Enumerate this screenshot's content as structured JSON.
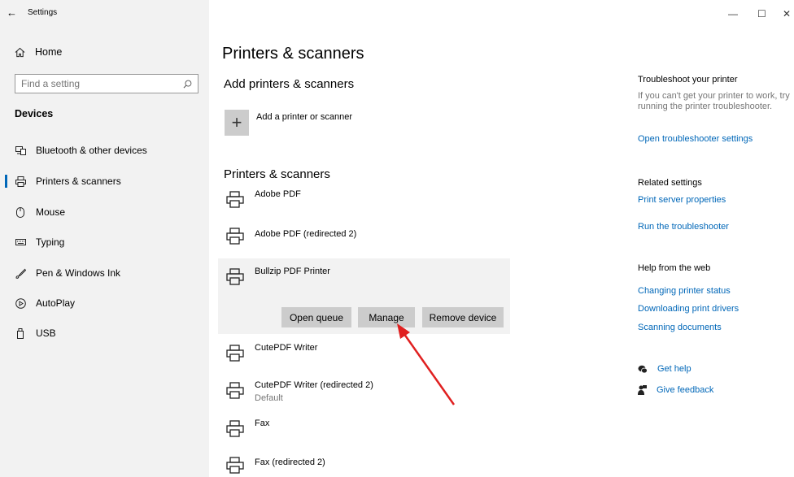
{
  "window": {
    "title": "Settings",
    "back_glyph": "←",
    "minimize_glyph": "—",
    "maximize_glyph": "☐",
    "close_glyph": "✕"
  },
  "sidebar": {
    "home_label": "Home",
    "search_placeholder": "Find a setting",
    "section_title": "Devices",
    "items": [
      {
        "label": "Bluetooth & other devices",
        "icon": "bluetooth-devices-icon",
        "active": false
      },
      {
        "label": "Printers & scanners",
        "icon": "printer-icon",
        "active": true
      },
      {
        "label": "Mouse",
        "icon": "mouse-icon",
        "active": false
      },
      {
        "label": "Typing",
        "icon": "keyboard-icon",
        "active": false
      },
      {
        "label": "Pen & Windows Ink",
        "icon": "pen-icon",
        "active": false
      },
      {
        "label": "AutoPlay",
        "icon": "autoplay-icon",
        "active": false
      },
      {
        "label": "USB",
        "icon": "usb-icon",
        "active": false
      }
    ]
  },
  "main": {
    "page_title": "Printers & scanners",
    "add_section_title": "Add printers & scanners",
    "add_label": "Add a printer or scanner",
    "list_title": "Printers & scanners",
    "printers": [
      {
        "name": "Adobe PDF",
        "sub": ""
      },
      {
        "name": "Adobe PDF (redirected 2)",
        "sub": ""
      },
      {
        "name": "Bullzip PDF Printer",
        "sub": "",
        "expanded": true
      },
      {
        "name": "CutePDF Writer",
        "sub": ""
      },
      {
        "name": "CutePDF Writer (redirected 2)",
        "sub": "Default"
      },
      {
        "name": "Fax",
        "sub": ""
      },
      {
        "name": "Fax (redirected 2)",
        "sub": ""
      }
    ],
    "buttons": {
      "open_queue": "Open queue",
      "manage": "Manage",
      "remove_device": "Remove device"
    }
  },
  "right": {
    "troubleshoot_title": "Troubleshoot your printer",
    "troubleshoot_text": "If you can't get your printer to work, try running the printer troubleshooter.",
    "troubleshoot_link": "Open troubleshooter settings",
    "related_title": "Related settings",
    "related_links": [
      "Print server properties",
      "Run the troubleshooter"
    ],
    "web_title": "Help from the web",
    "web_links": [
      "Changing printer status",
      "Downloading print drivers",
      "Scanning documents"
    ],
    "get_help": "Get help",
    "give_feedback": "Give feedback"
  },
  "colors": {
    "accent": "#0067b8",
    "sidebar_bg": "#f2f2f2",
    "button_bg": "#cccccc",
    "annotation_arrow": "#e02020"
  }
}
